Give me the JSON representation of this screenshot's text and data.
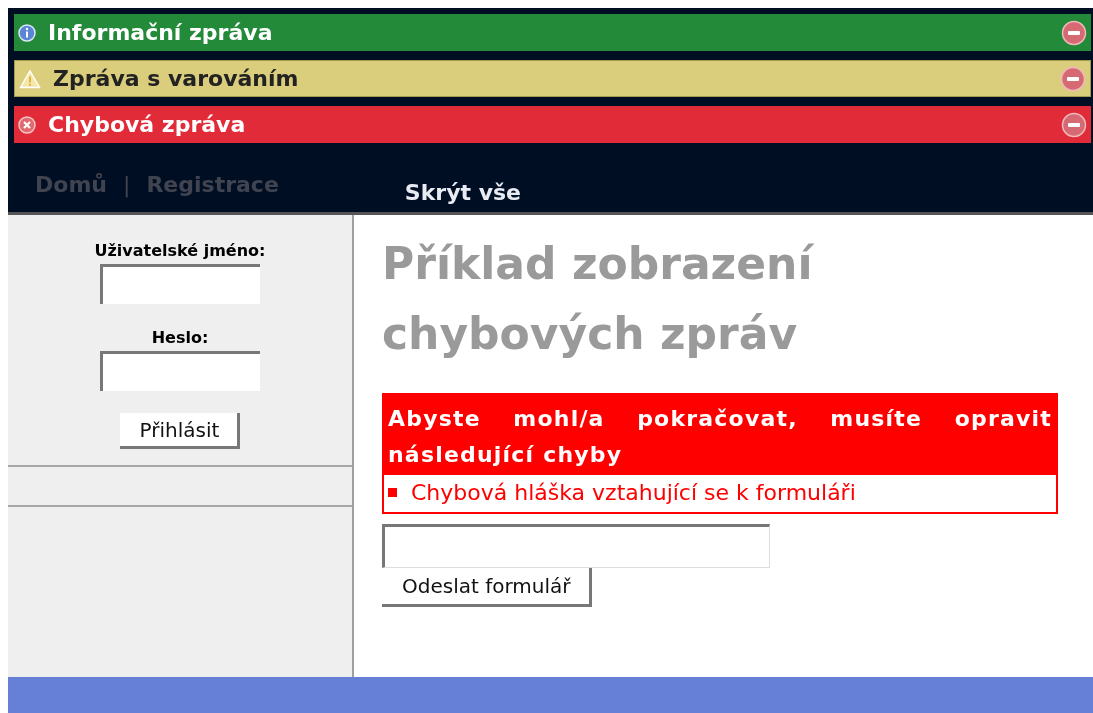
{
  "messages": [
    {
      "kind": "info",
      "text": "Informační zpráva"
    },
    {
      "kind": "warning",
      "text": "Zpráva s varováním"
    },
    {
      "kind": "error",
      "text": "Chybová zpráva"
    }
  ],
  "nav": {
    "links": [
      "Domů",
      "Registrace"
    ],
    "separator": "|",
    "hide_all": "Skrýt vše"
  },
  "login": {
    "username_label": "Uživatelské jméno:",
    "password_label": "Heslo:",
    "submit": "Přihlásit"
  },
  "main": {
    "title": "Příklad zobrazení chybových zpráv",
    "error_box": {
      "heading": "Abyste mohl/a pokračovat, musíte opravit následující chyby",
      "items": [
        "Chybová hláška vztahující se k formuláři"
      ]
    },
    "submit": "Odeslat formulář"
  }
}
